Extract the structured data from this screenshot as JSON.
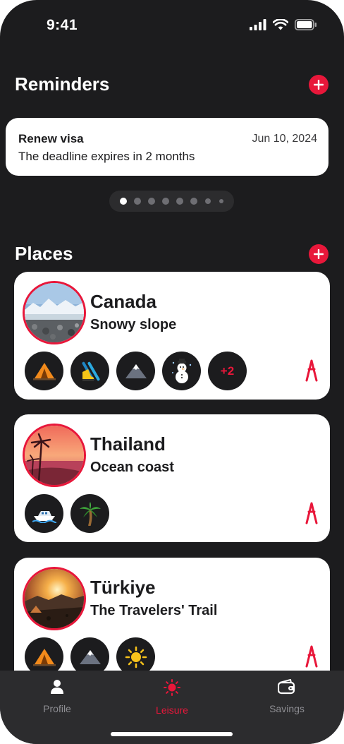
{
  "status_bar": {
    "time": "9:41"
  },
  "reminders": {
    "title": "Reminders",
    "card": {
      "title": "Renew visa",
      "date": "Jun 10, 2024",
      "description": "The deadline expires in 2 months"
    },
    "pager": {
      "count": 8,
      "active_index": 0
    }
  },
  "places": {
    "title": "Places",
    "items": [
      {
        "name": "Canada",
        "subtitle": "Snowy slope",
        "icons": [
          "tent-icon",
          "ski-boot-icon",
          "mountain-icon",
          "snowman-icon"
        ],
        "more_label": "+2"
      },
      {
        "name": "Thailand",
        "subtitle": "Ocean coast",
        "icons": [
          "boat-icon",
          "palm-tree-icon"
        ]
      },
      {
        "name": "Türkiye",
        "subtitle": "The Travelers' Trail",
        "icons": [
          "tent-icon",
          "mountain-icon",
          "sun-icon"
        ]
      }
    ]
  },
  "tab_bar": {
    "tabs": [
      {
        "label": "Profile",
        "icon": "person-icon"
      },
      {
        "label": "Leisure",
        "icon": "sun-icon",
        "active": true
      },
      {
        "label": "Savings",
        "icon": "wallet-icon"
      }
    ]
  },
  "colors": {
    "accent": "#e8173a",
    "background": "#1c1c1e",
    "card": "#ffffff"
  }
}
